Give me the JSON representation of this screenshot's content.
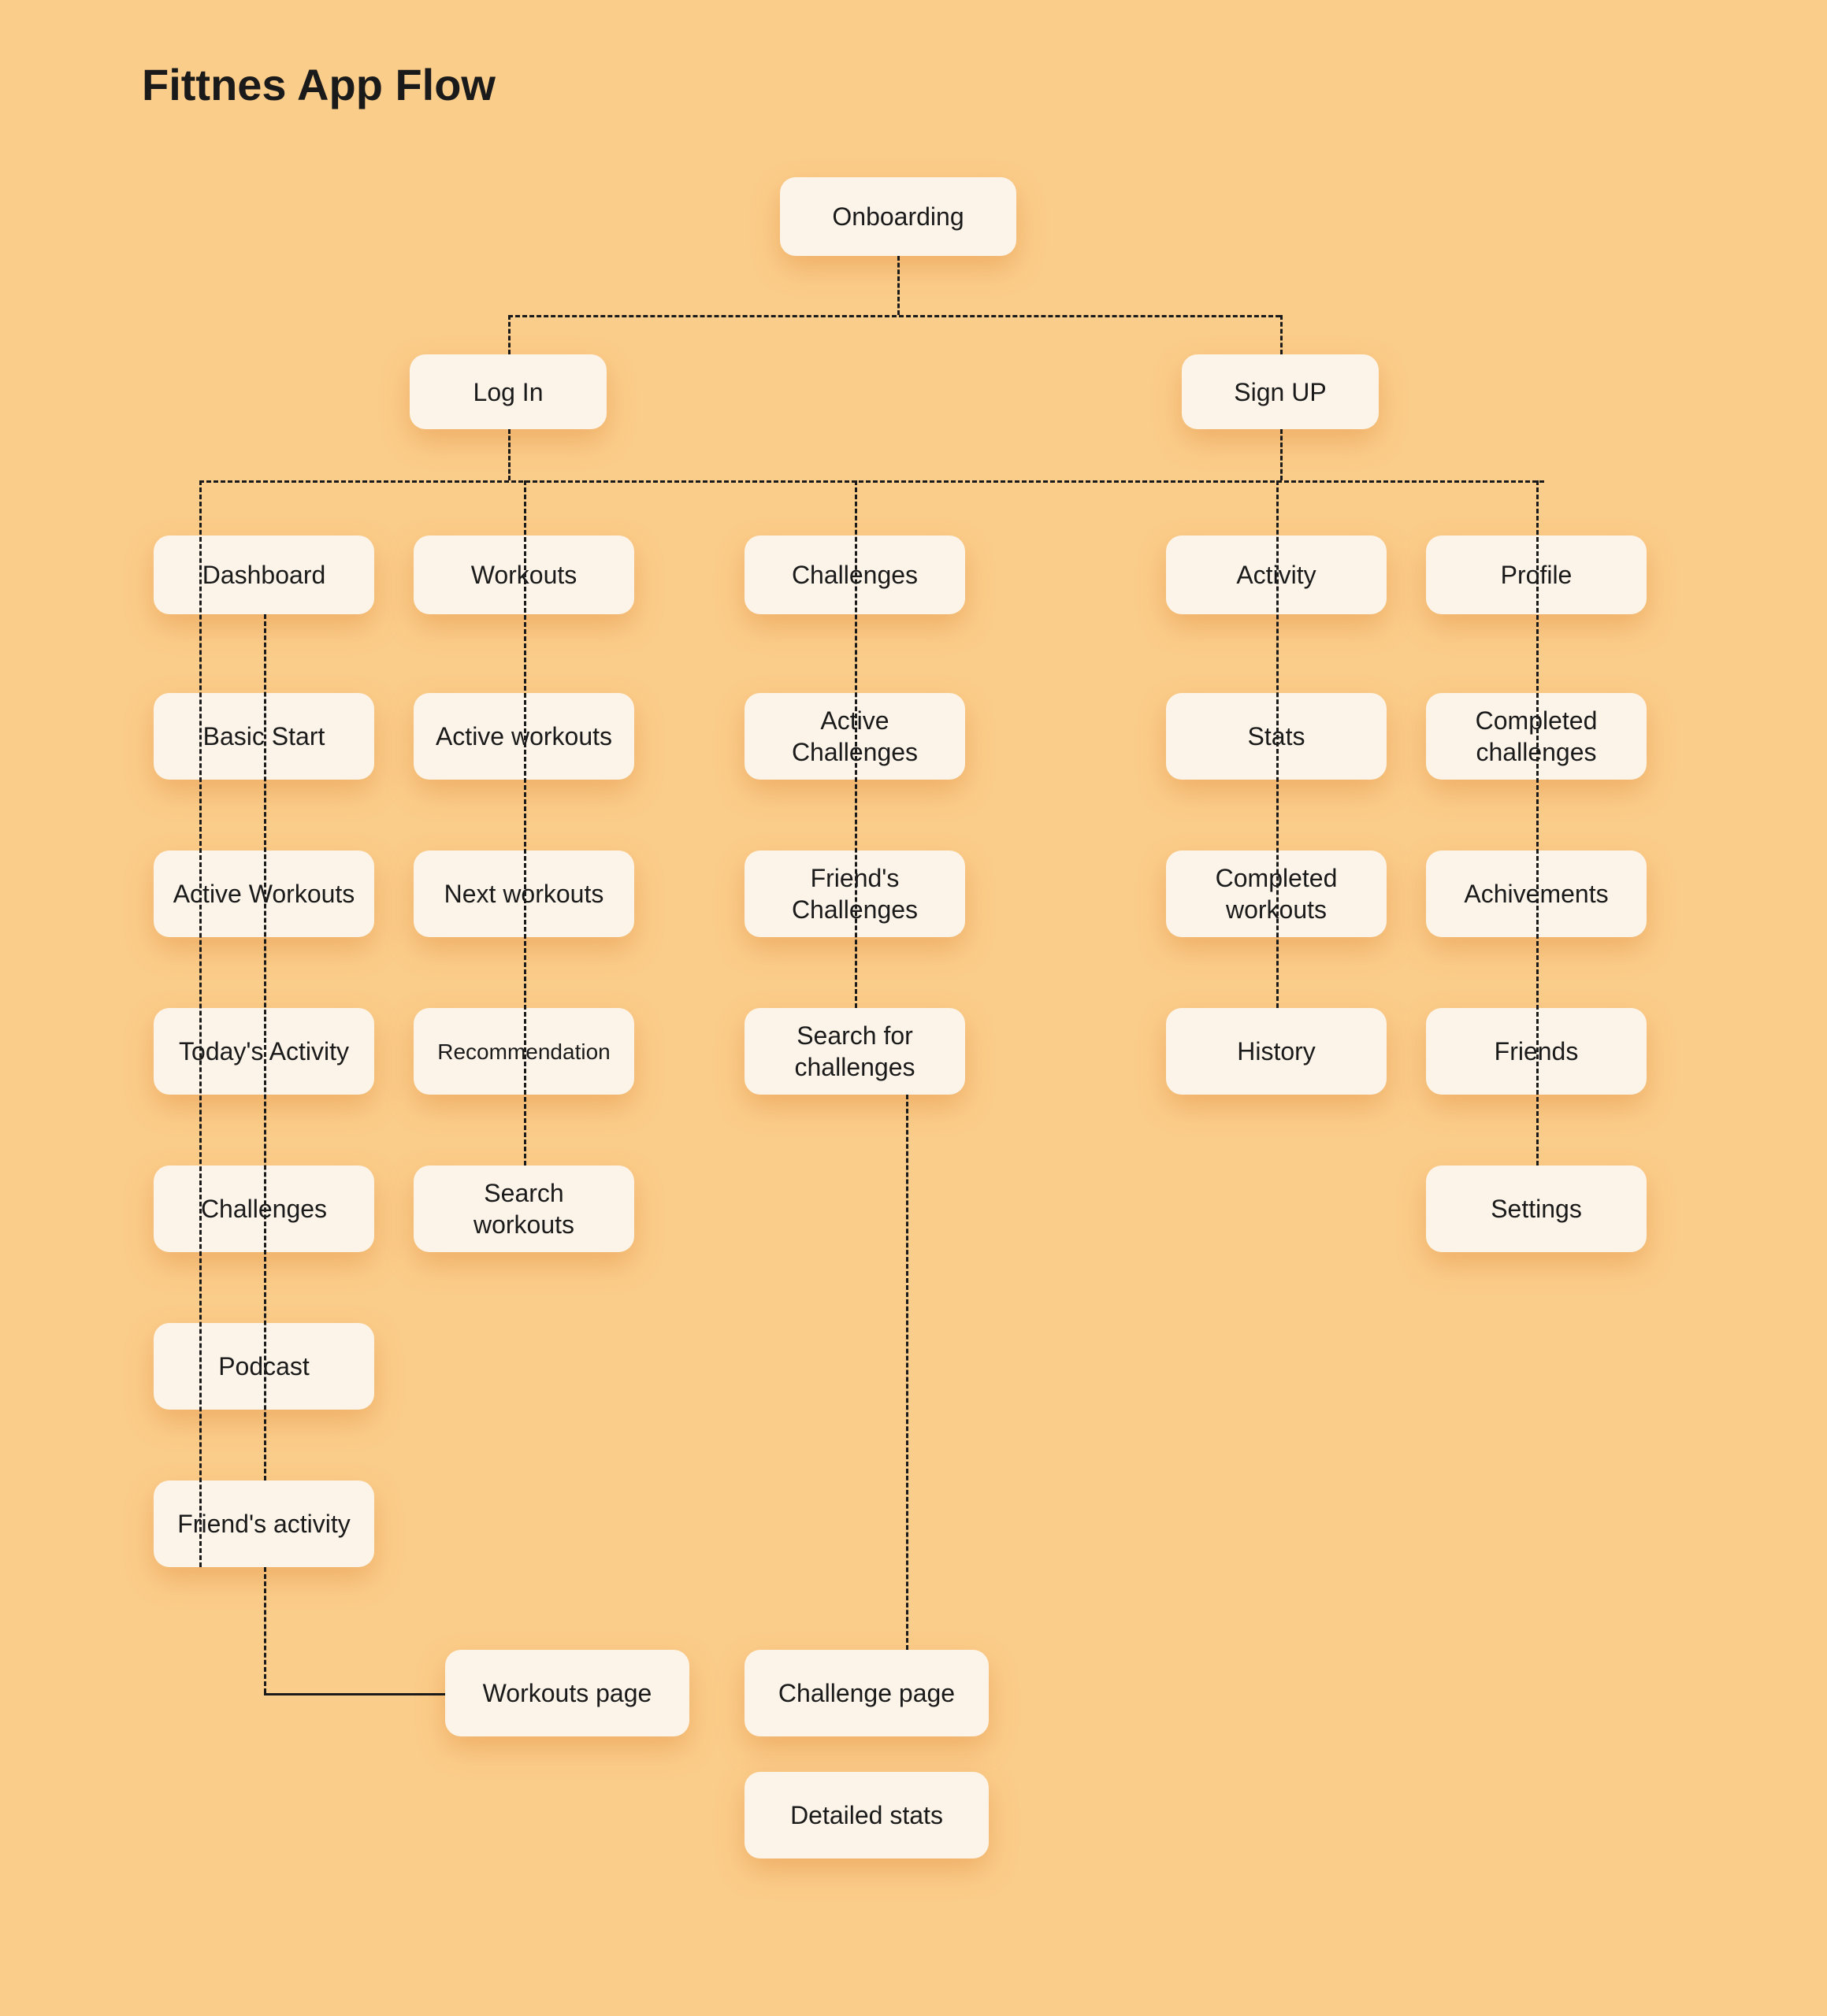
{
  "title": "Fittnes App Flow",
  "nodes": {
    "onboarding": "Onboarding",
    "login": "Log In",
    "signup": "Sign UP",
    "dashboard": "Dashboard",
    "workouts": "Workouts",
    "challenges": "Challenges",
    "activity": "Activity",
    "profile": "Profile",
    "basic_start": "Basic Start",
    "active_workouts_d": "Active Workouts",
    "todays_activity": "Today's Activity",
    "challenges_d": "Challenges",
    "podcast": "Podcast",
    "friends_activity": "Friend's activity",
    "active_workouts_w": "Active workouts",
    "next_workouts": "Next workouts",
    "recommendation": "Recommendation",
    "search_workouts": "Search workouts",
    "active_challenges": "Active Challenges",
    "friends_challenges": "Friend's Challenges",
    "search_challenges": "Search for challenges",
    "stats": "Stats",
    "completed_workouts": "Completed workouts",
    "history": "History",
    "completed_challenges": "Completed challenges",
    "achievements": "Achivements",
    "friends": "Friends",
    "settings": "Settings",
    "workouts_page": "Workouts page",
    "challenge_page": "Challenge page",
    "detailed_stats": "Detailed stats"
  }
}
